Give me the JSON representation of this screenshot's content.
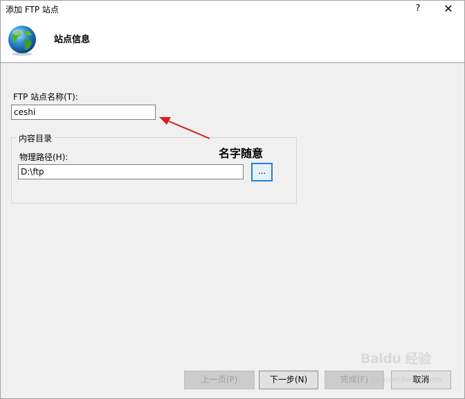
{
  "window": {
    "title": "添加 FTP 站点",
    "help_label": "?",
    "close_label": "✕"
  },
  "header": {
    "title": "站点信息",
    "icon": "globe-icon"
  },
  "form": {
    "site_name_label": "FTP 站点名称(T):",
    "site_name_value": "ceshi",
    "content_dir_group_label": "内容目录",
    "physical_path_label": "物理路径(H):",
    "physical_path_value": "D:\\ftp",
    "browse_label": "..."
  },
  "annotation": {
    "text": "名字随意",
    "color": "#d42020"
  },
  "buttons": {
    "previous": "上一页(P)",
    "next": "下一步(N)",
    "finish": "完成(F)",
    "cancel": "取消"
  },
  "watermark": {
    "brand": "Baidu 经验",
    "url": "jingyan.baidu.com"
  }
}
